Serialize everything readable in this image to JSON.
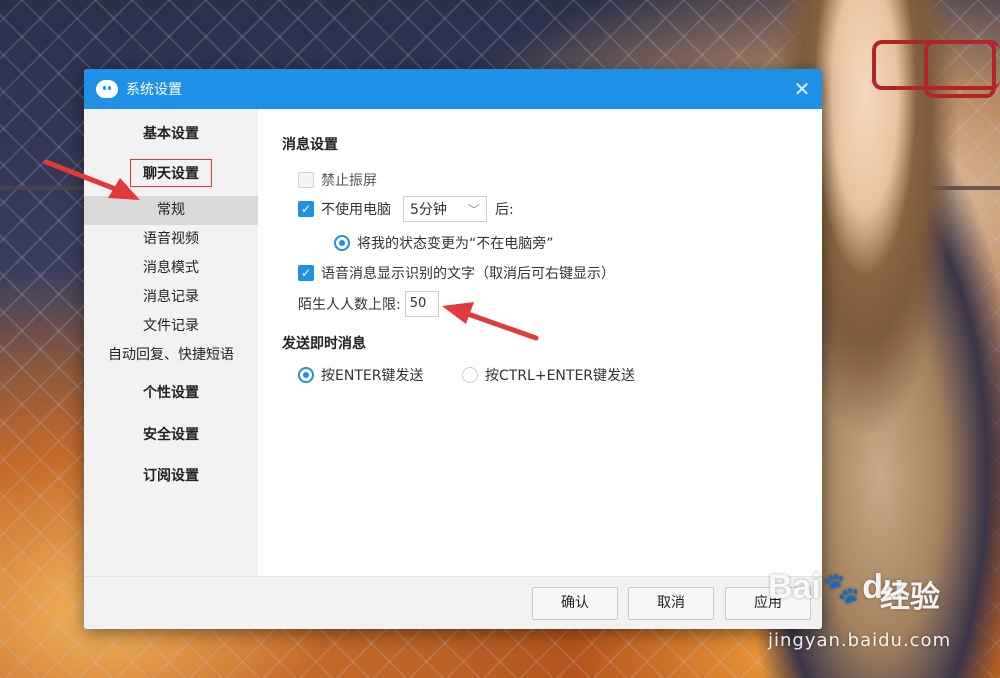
{
  "window": {
    "title": "系统设置"
  },
  "sidebar": {
    "categories": [
      {
        "label": "基本设置"
      },
      {
        "label": "聊天设置"
      },
      {
        "label": "个性设置"
      },
      {
        "label": "安全设置"
      },
      {
        "label": "订阅设置"
      }
    ],
    "chat_items": [
      {
        "label": "常规",
        "active": true
      },
      {
        "label": "语音视频"
      },
      {
        "label": "消息模式"
      },
      {
        "label": "消息记录"
      },
      {
        "label": "文件记录"
      },
      {
        "label": "自动回复、快捷短语"
      }
    ]
  },
  "message_settings": {
    "title": "消息设置",
    "disable_vibrate": {
      "label": "禁止振屏",
      "checked": false
    },
    "away": {
      "label": "不使用电脑",
      "checked": true,
      "duration": "5分钟",
      "suffix": "后:"
    },
    "away_status": {
      "label": "将我的状态变更为“不在电脑旁”",
      "selected": true
    },
    "voice_text": {
      "label": "语音消息显示识别的文字（取消后可右键显示）",
      "checked": true
    },
    "stranger_limit": {
      "label": "陌生人人数上限:",
      "value": "50"
    }
  },
  "send_settings": {
    "title": "发送即时消息",
    "options": [
      {
        "label": "按ENTER键发送",
        "selected": true
      },
      {
        "label": "按CTRL+ENTER键发送",
        "selected": false
      }
    ]
  },
  "footer": {
    "ok": "确认",
    "cancel": "取消",
    "apply": "应用"
  },
  "watermark": {
    "brand": "Bai",
    "brand2": "du",
    "jingyan": "经验",
    "url": "jingyan.baidu.com"
  },
  "colors": {
    "accent": "#1e90e6",
    "annotation": "#e23a3a"
  },
  "icons": [
    "app-logo-icon",
    "close-icon",
    "chevron-down-icon",
    "check-icon",
    "paw-icon"
  ]
}
